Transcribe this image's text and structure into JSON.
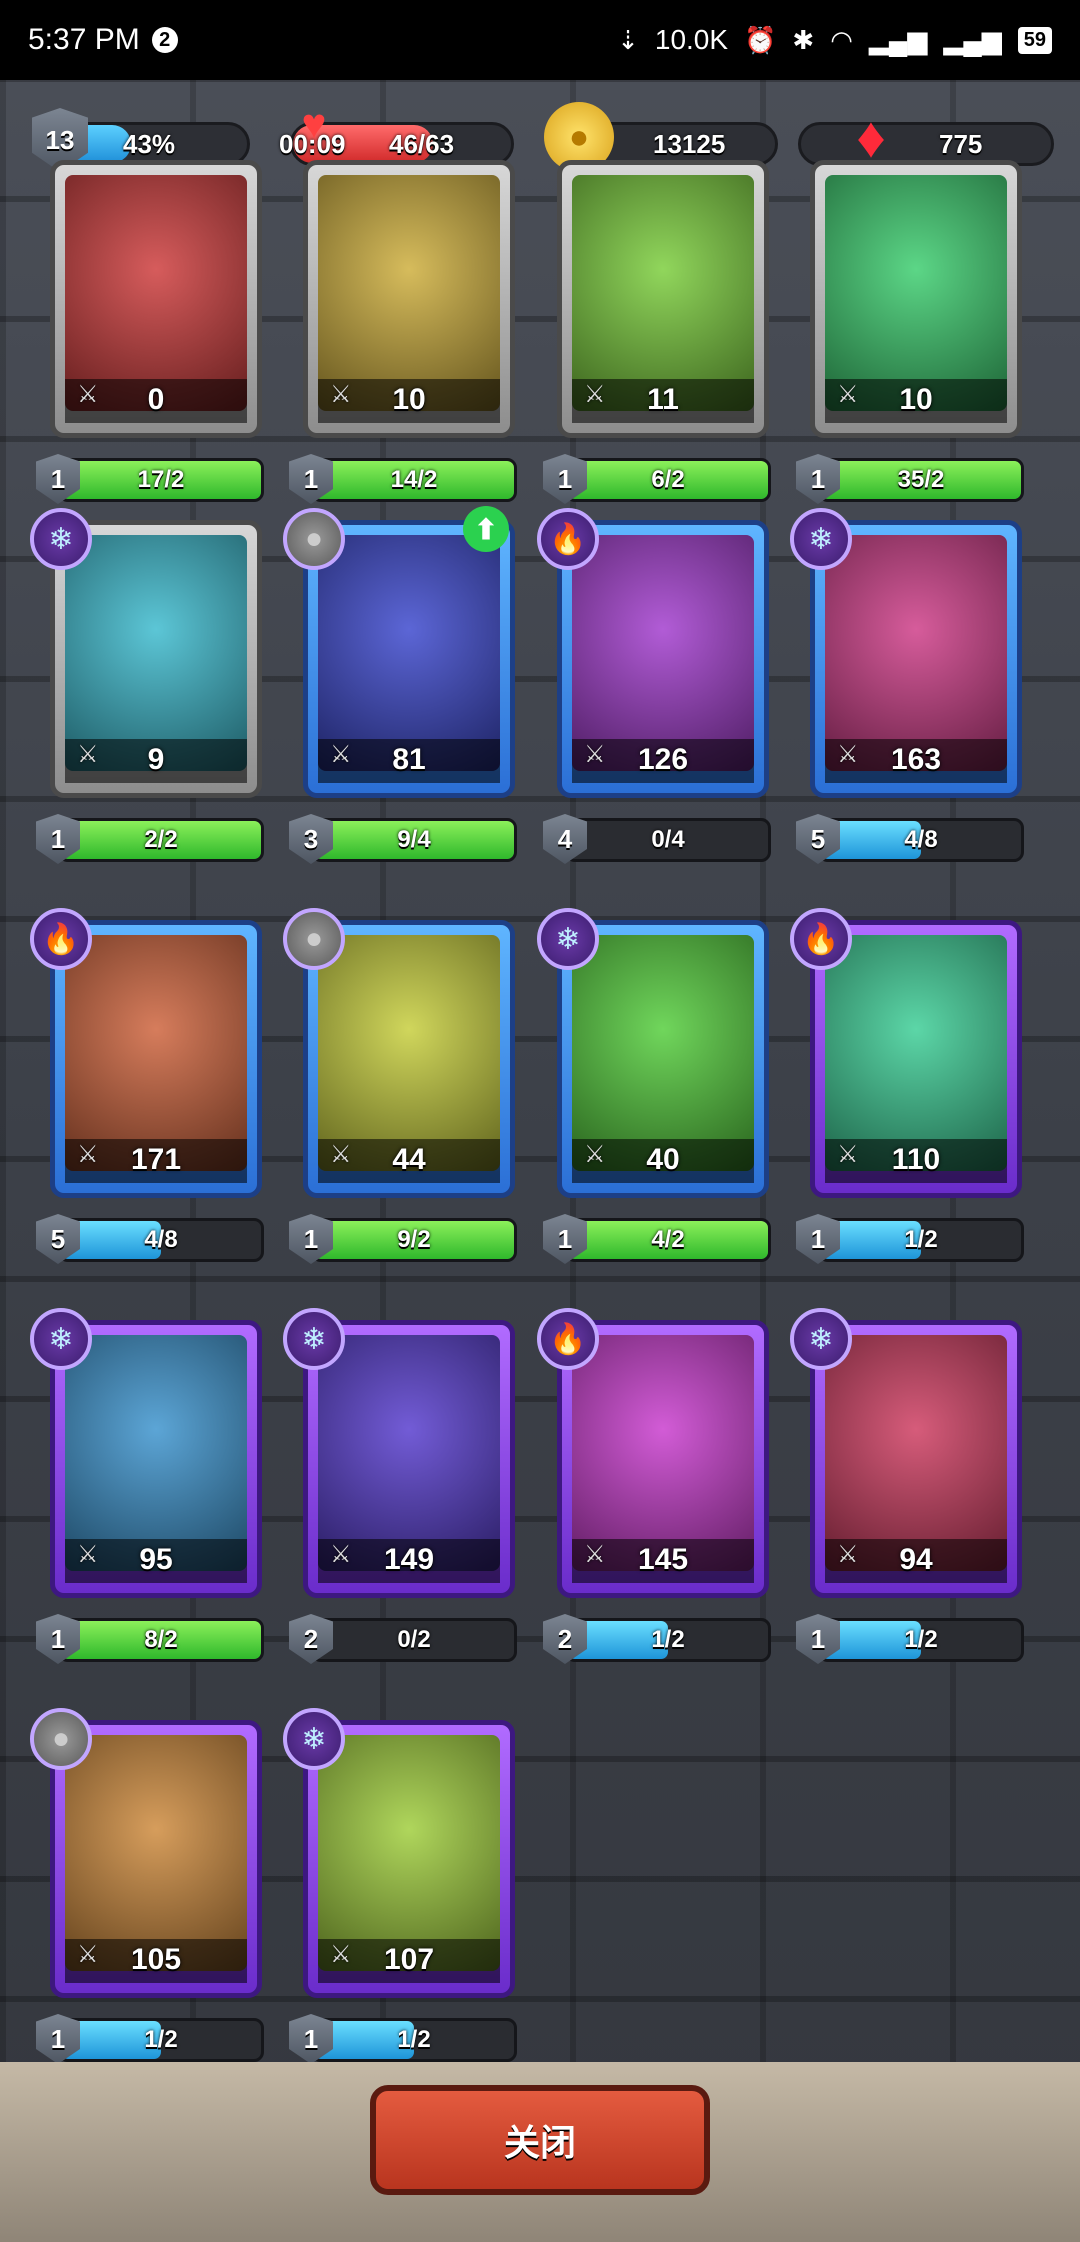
{
  "status_bar": {
    "time": "5:37 PM",
    "notif_count": "2",
    "net_speed": "10.0K",
    "battery": "59"
  },
  "resources": {
    "level": "13",
    "xp_percent": "43%",
    "xp_fraction": 0.43,
    "timer": "00:09",
    "energy": "46/63",
    "coins": "13125",
    "gems": "775"
  },
  "cards": [
    {
      "power": "0",
      "level": "1",
      "progress": "17/2",
      "fill": 1.0,
      "fill_color": "green",
      "rarity": "common",
      "element": "none"
    },
    {
      "power": "10",
      "level": "1",
      "progress": "14/2",
      "fill": 1.0,
      "fill_color": "green",
      "rarity": "common",
      "element": "none"
    },
    {
      "power": "11",
      "level": "1",
      "progress": "6/2",
      "fill": 1.0,
      "fill_color": "green",
      "rarity": "common",
      "element": "none"
    },
    {
      "power": "10",
      "level": "1",
      "progress": "35/2",
      "fill": 1.0,
      "fill_color": "green",
      "rarity": "common",
      "element": "none"
    },
    {
      "power": "9",
      "level": "1",
      "progress": "2/2",
      "fill": 1.0,
      "fill_color": "green",
      "rarity": "common",
      "element": "ice"
    },
    {
      "power": "81",
      "level": "3",
      "progress": "9/4",
      "fill": 1.0,
      "fill_color": "green",
      "rarity": "rare",
      "element": "stone",
      "upgrade": true
    },
    {
      "power": "126",
      "level": "4",
      "progress": "0/4",
      "fill": 0.0,
      "fill_color": "blue",
      "rarity": "rare",
      "element": "fire"
    },
    {
      "power": "163",
      "level": "5",
      "progress": "4/8",
      "fill": 0.5,
      "fill_color": "blue",
      "rarity": "rare",
      "element": "ice"
    },
    {
      "power": "171",
      "level": "5",
      "progress": "4/8",
      "fill": 0.5,
      "fill_color": "blue",
      "rarity": "rare",
      "element": "fire"
    },
    {
      "power": "44",
      "level": "1",
      "progress": "9/2",
      "fill": 1.0,
      "fill_color": "green",
      "rarity": "rare",
      "element": "stone"
    },
    {
      "power": "40",
      "level": "1",
      "progress": "4/2",
      "fill": 1.0,
      "fill_color": "green",
      "rarity": "rare",
      "element": "ice"
    },
    {
      "power": "110",
      "level": "1",
      "progress": "1/2",
      "fill": 0.5,
      "fill_color": "blue",
      "rarity": "epic",
      "element": "fire"
    },
    {
      "power": "95",
      "level": "1",
      "progress": "8/2",
      "fill": 1.0,
      "fill_color": "green",
      "rarity": "epic",
      "element": "ice"
    },
    {
      "power": "149",
      "level": "2",
      "progress": "0/2",
      "fill": 0.0,
      "fill_color": "blue",
      "rarity": "epic",
      "element": "ice"
    },
    {
      "power": "145",
      "level": "2",
      "progress": "1/2",
      "fill": 0.5,
      "fill_color": "blue",
      "rarity": "epic",
      "element": "fire"
    },
    {
      "power": "94",
      "level": "1",
      "progress": "1/2",
      "fill": 0.5,
      "fill_color": "blue",
      "rarity": "epic",
      "element": "ice"
    },
    {
      "power": "105",
      "level": "1",
      "progress": "1/2",
      "fill": 0.5,
      "fill_color": "blue",
      "rarity": "epic",
      "element": "stone"
    },
    {
      "power": "107",
      "level": "1",
      "progress": "1/2",
      "fill": 0.5,
      "fill_color": "blue",
      "rarity": "epic",
      "element": "ice"
    }
  ],
  "close_label": "关闭"
}
